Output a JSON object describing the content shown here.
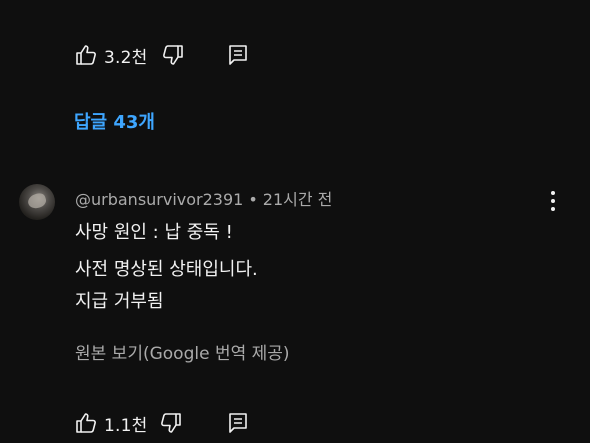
{
  "top_actions": {
    "like_count": "3.2천"
  },
  "replies": {
    "label": "답글 43개"
  },
  "comment": {
    "username": "@urbansurvivor2391",
    "separator": "•",
    "time": "21시간 전",
    "lines": [
      "사망 원인 : 납 중독 !",
      "사전 명상된 상태입니다.",
      "지급 거부됨"
    ],
    "translate_label": "원본 보기(Google 번역 제공)",
    "like_count": "1.1천"
  },
  "icons": {
    "like": "thumbs-up-icon",
    "dislike": "thumbs-down-icon",
    "reply": "comment-icon",
    "more": "more-vert-icon"
  },
  "colors": {
    "background": "#0f0f0f",
    "text": "#f1f1f1",
    "secondary": "#aaaaaa",
    "accent": "#3ea6ff"
  }
}
